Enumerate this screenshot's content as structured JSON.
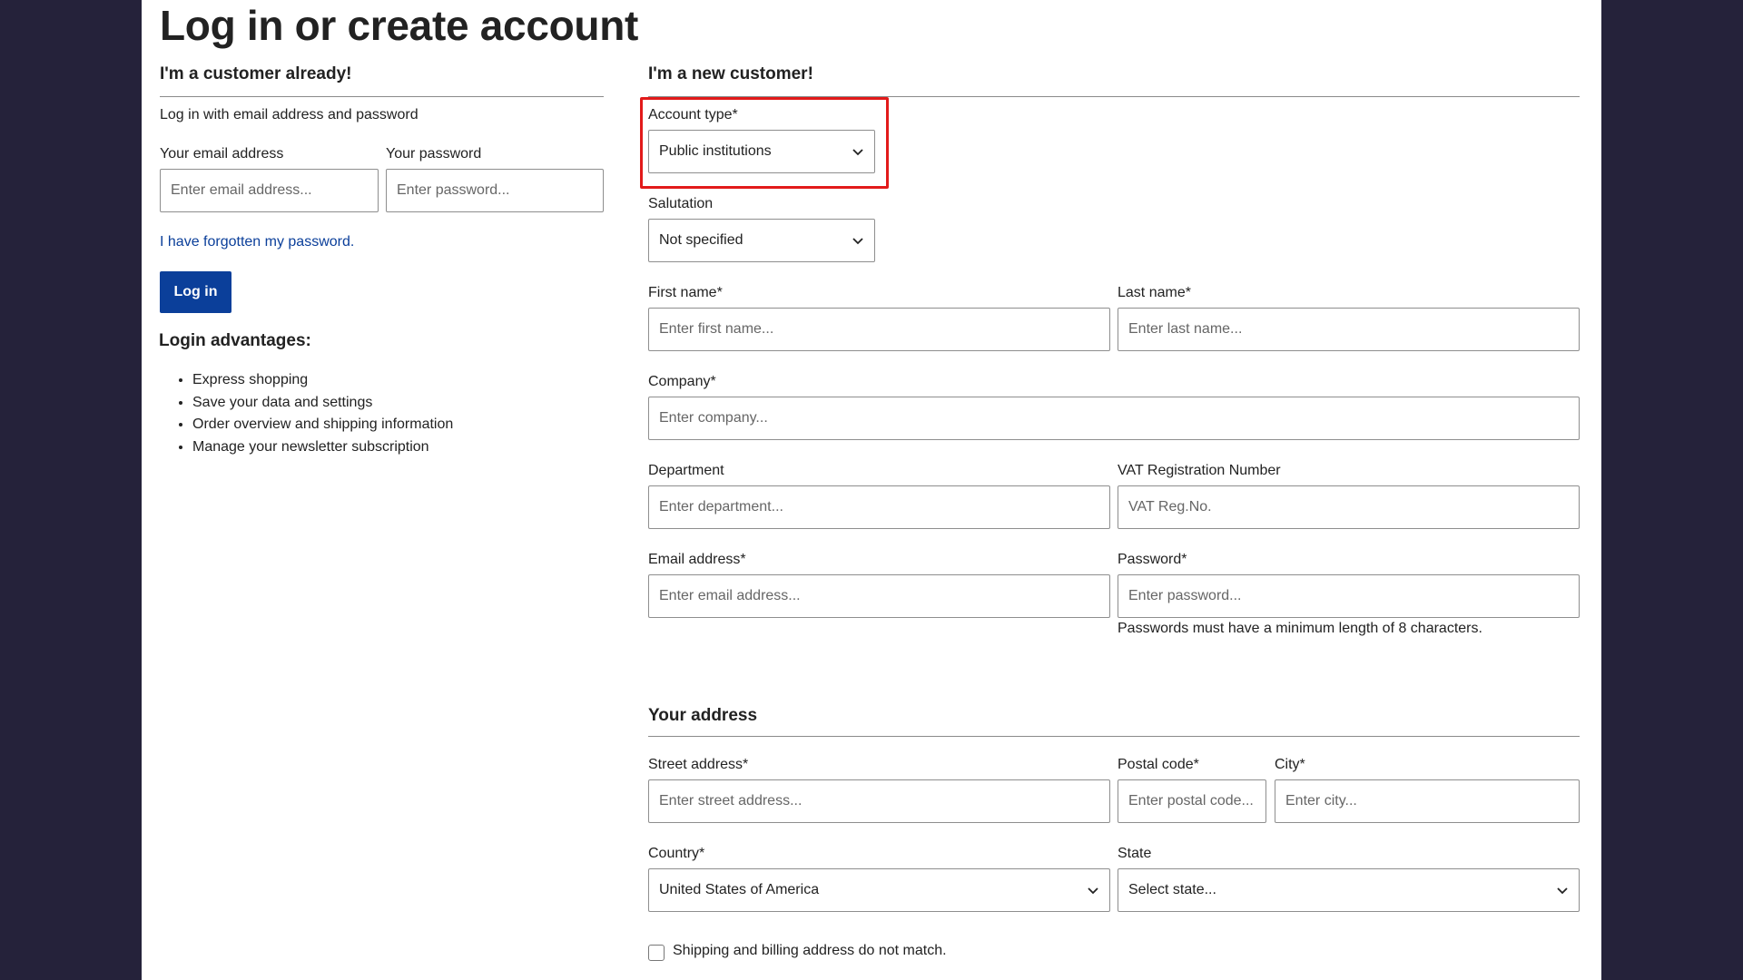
{
  "page": {
    "title": "Log in or create account"
  },
  "login": {
    "heading": "I'm a customer already!",
    "intro": "Log in with email address and password",
    "email_label": "Your email address",
    "email_placeholder": "Enter email address...",
    "password_label": "Your password",
    "password_placeholder": "Enter password...",
    "forgot_link": "I have forgotten my password.",
    "login_button": "Log in",
    "advantages_heading": "Login advantages:",
    "advantages": [
      "Express shopping",
      "Save your data and settings",
      "Order overview and shipping information",
      "Manage your newsletter subscription"
    ]
  },
  "register": {
    "heading": "I'm a new customer!",
    "account_type_label": "Account type*",
    "account_type_value": "Public institutions",
    "salutation_label": "Salutation",
    "salutation_value": "Not specified",
    "first_name_label": "First name*",
    "first_name_placeholder": "Enter first name...",
    "last_name_label": "Last name*",
    "last_name_placeholder": "Enter last name...",
    "company_label": "Company*",
    "company_placeholder": "Enter company...",
    "department_label": "Department",
    "department_placeholder": "Enter department...",
    "vat_label": "VAT Registration Number",
    "vat_placeholder": "VAT Reg.No.",
    "email_label": "Email address*",
    "email_placeholder": "Enter email address...",
    "password_label": "Password*",
    "password_placeholder": "Enter password...",
    "password_hint": "Passwords must have a minimum length of 8 characters."
  },
  "address": {
    "heading": "Your address",
    "street_label": "Street address*",
    "street_placeholder": "Enter street address...",
    "postal_label": "Postal code*",
    "postal_placeholder": "Enter postal code...",
    "city_label": "City*",
    "city_placeholder": "Enter city...",
    "country_label": "Country*",
    "country_value": "United States of America",
    "state_label": "State",
    "state_value": "Select state...",
    "different_billing_label": "Shipping and billing address do not match."
  },
  "colors": {
    "brand_blue": "#0b3f9a",
    "highlight_red": "#e21a1a",
    "frame_background": "#25223a"
  }
}
